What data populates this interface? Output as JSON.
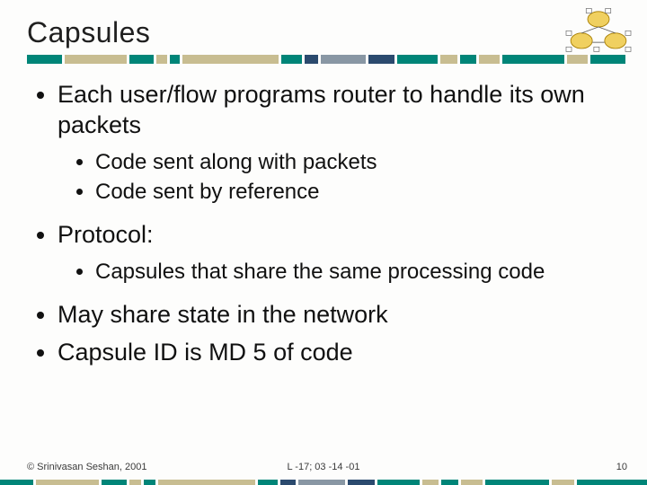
{
  "title": "Capsules",
  "bullets": {
    "b1": "Each user/flow programs router to handle its own packets",
    "b1_sub1": "Code sent along with packets",
    "b1_sub2": "Code sent by reference",
    "b2": "Protocol:",
    "b2_sub1": "Capsules that share the same processing code",
    "b3": "May share state in the network",
    "b4": "Capsule ID is MD 5 of code"
  },
  "footer": {
    "left": "© Srinivasan Seshan, 2001",
    "center": "L -17; 03 -14 -01",
    "right": "10"
  },
  "colors": {
    "teal": "#008578",
    "tan": "#c8bd91",
    "navy": "#2b4a6e",
    "slate": "#8997a4"
  }
}
